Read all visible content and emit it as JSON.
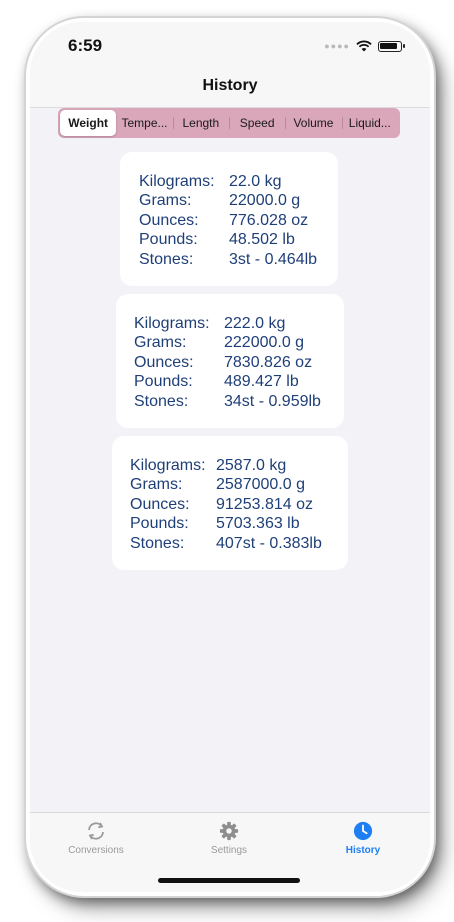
{
  "status_bar": {
    "time": "6:59"
  },
  "navbar": {
    "title": "History"
  },
  "segments": [
    "Weight",
    "Tempe...",
    "Length",
    "Speed",
    "Volume",
    "Liquid..."
  ],
  "selected_segment": "Weight",
  "labels": {
    "kilograms": "Kilograms:",
    "grams": "Grams:",
    "ounces": "Ounces:",
    "pounds": "Pounds:",
    "stones": "Stones:"
  },
  "history": [
    {
      "kilograms": "22.0 kg",
      "grams": "22000.0 g",
      "ounces": "776.028 oz",
      "pounds": "48.502 lb",
      "stones": "3st - 0.464lb"
    },
    {
      "kilograms": "222.0 kg",
      "grams": "222000.0 g",
      "ounces": "7830.826 oz",
      "pounds": "489.427 lb",
      "stones": "34st - 0.959lb"
    },
    {
      "kilograms": "2587.0 kg",
      "grams": "2587000.0 g",
      "ounces": "91253.814 oz",
      "pounds": "5703.363 lb",
      "stones": "407st - 0.383lb"
    }
  ],
  "tabbar": {
    "tabs": [
      {
        "label": "Conversions",
        "icon": "arrows-rotate-icon"
      },
      {
        "label": "Settings",
        "icon": "gear-icon"
      },
      {
        "label": "History",
        "icon": "clock-icon"
      }
    ],
    "active": "History",
    "active_color": "#1d7ff3",
    "inactive_color": "#9a9a9a"
  },
  "colors": {
    "segment_bg": "#d9a6ba",
    "card_text": "#1f3f78",
    "background": "#f2f2f7"
  }
}
